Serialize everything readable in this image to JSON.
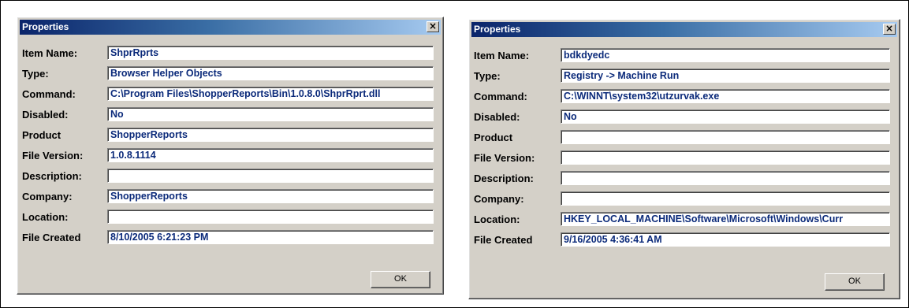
{
  "dialogs": [
    {
      "title": "Properties",
      "close_glyph": "×",
      "ok_label": "OK",
      "fields": [
        {
          "label": "Item Name:",
          "value": "ShprRprts"
        },
        {
          "label": "Type:",
          "value": "Browser Helper Objects"
        },
        {
          "label": "Command:",
          "value": "C:\\Program Files\\ShopperReports\\Bin\\1.0.8.0\\ShprRprt.dll"
        },
        {
          "label": "Disabled:",
          "value": "No"
        },
        {
          "label": "Product",
          "value": "ShopperReports"
        },
        {
          "label": "File Version:",
          "value": "1.0.8.1114"
        },
        {
          "label": "Description:",
          "value": ""
        },
        {
          "label": "Company:",
          "value": "ShopperReports"
        },
        {
          "label": "Location:",
          "value": ""
        },
        {
          "label": "File Created",
          "value": "8/10/2005 6:21:23 PM"
        }
      ]
    },
    {
      "title": "Properties",
      "close_glyph": "×",
      "ok_label": "OK",
      "fields": [
        {
          "label": "Item Name:",
          "value": "bdkdyedc"
        },
        {
          "label": "Type:",
          "value": "Registry -> Machine Run"
        },
        {
          "label": "Command:",
          "value": "C:\\WINNT\\system32\\utzurvak.exe"
        },
        {
          "label": "Disabled:",
          "value": "No"
        },
        {
          "label": "Product",
          "value": ""
        },
        {
          "label": "File Version:",
          "value": ""
        },
        {
          "label": "Description:",
          "value": ""
        },
        {
          "label": "Company:",
          "value": ""
        },
        {
          "label": "Location:",
          "value": "HKEY_LOCAL_MACHINE\\Software\\Microsoft\\Windows\\Curr"
        },
        {
          "label": "File Created",
          "value": "9/16/2005 4:36:41 AM"
        }
      ]
    }
  ]
}
